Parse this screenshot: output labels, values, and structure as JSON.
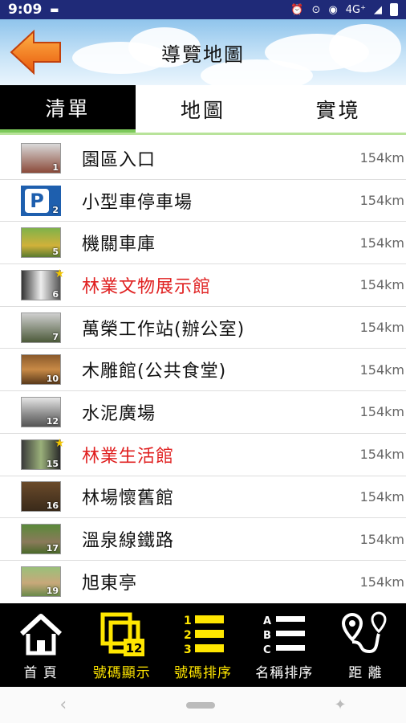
{
  "status": {
    "time": "9:09",
    "network": "4G⁺"
  },
  "header": {
    "title": "導覽地圖"
  },
  "tabs": [
    {
      "label": "清單",
      "active": true
    },
    {
      "label": "地圖",
      "active": false
    },
    {
      "label": "實境",
      "active": false
    }
  ],
  "items": [
    {
      "num": "1",
      "name": "園區入口",
      "dist": "154km",
      "highlight": false,
      "star": false
    },
    {
      "num": "2",
      "name": "小型車停車場",
      "dist": "154km",
      "highlight": false,
      "star": false
    },
    {
      "num": "5",
      "name": "機關車庫",
      "dist": "154km",
      "highlight": false,
      "star": false
    },
    {
      "num": "6",
      "name": "林業文物展示館",
      "dist": "154km",
      "highlight": true,
      "star": true
    },
    {
      "num": "7",
      "name": "萬榮工作站(辦公室)",
      "dist": "154km",
      "highlight": false,
      "star": false
    },
    {
      "num": "10",
      "name": "木雕館(公共食堂)",
      "dist": "154km",
      "highlight": false,
      "star": false
    },
    {
      "num": "12",
      "name": "水泥廣場",
      "dist": "154km",
      "highlight": false,
      "star": false
    },
    {
      "num": "15",
      "name": "林業生活館",
      "dist": "154km",
      "highlight": true,
      "star": true
    },
    {
      "num": "16",
      "name": "林場懷舊館",
      "dist": "154km",
      "highlight": false,
      "star": false
    },
    {
      "num": "17",
      "name": "溫泉線鐵路",
      "dist": "154km",
      "highlight": false,
      "star": false
    },
    {
      "num": "19",
      "name": "旭東亭",
      "dist": "154km",
      "highlight": false,
      "star": false
    }
  ],
  "bottom_bar": [
    {
      "label": "首 頁",
      "icon": "home-icon",
      "active": false
    },
    {
      "label": "號碼顯示",
      "icon": "number-display-icon",
      "active": true,
      "badge": "12"
    },
    {
      "label": "號碼排序",
      "icon": "number-sort-icon",
      "active": true,
      "digits": [
        "1",
        "2",
        "3"
      ]
    },
    {
      "label": "名稱排序",
      "icon": "name-sort-icon",
      "active": false,
      "letters": [
        "A",
        "B",
        "C"
      ]
    },
    {
      "label": "距 離",
      "icon": "distance-icon",
      "active": false
    }
  ],
  "colors": {
    "status_bar": "#1f2a78",
    "highlight_text": "#e02020",
    "accent_yellow": "#ffe600",
    "tab_underline": "#7cc95a"
  }
}
